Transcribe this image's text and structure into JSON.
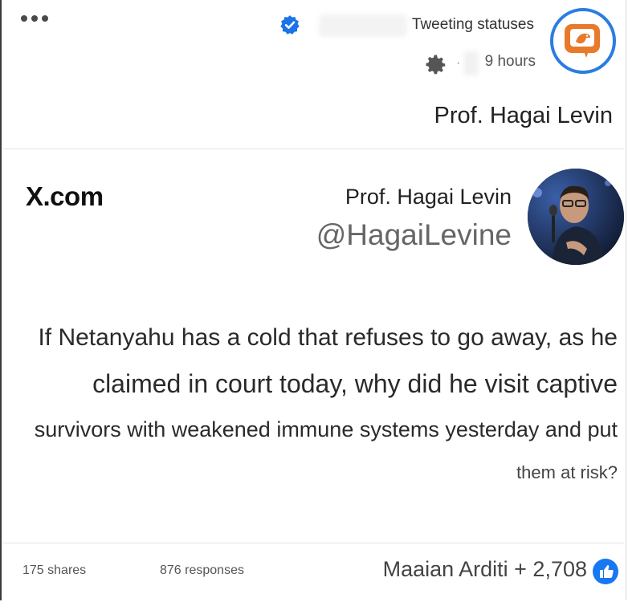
{
  "header": {
    "more_menu": "more-options",
    "group_name": "Tweeting statuses",
    "time_ago": "9 hours",
    "separator": "·",
    "author_name": "Prof. Hagai Levin"
  },
  "tweet": {
    "source": "X.com",
    "name": "Prof. Hagai Levin",
    "handle": "@HagaiLevine",
    "lines": [
      "If Netanyahu has a cold that refuses to go away, as he",
      "claimed in court today, why did he visit captive",
      "survivors with weakened immune systems yesterday and put",
      "them at risk?"
    ]
  },
  "footer": {
    "shares": "175 shares",
    "responses": "876 responses",
    "reactions": "Maaian Arditi + 2,708"
  },
  "colors": {
    "accent_blue": "#2a7de1",
    "avatar_orange": "#e87a2a"
  },
  "icons": [
    "more-icon",
    "verified-badge-icon",
    "privacy-gear-icon",
    "group-avatar-icon",
    "like-icon"
  ]
}
